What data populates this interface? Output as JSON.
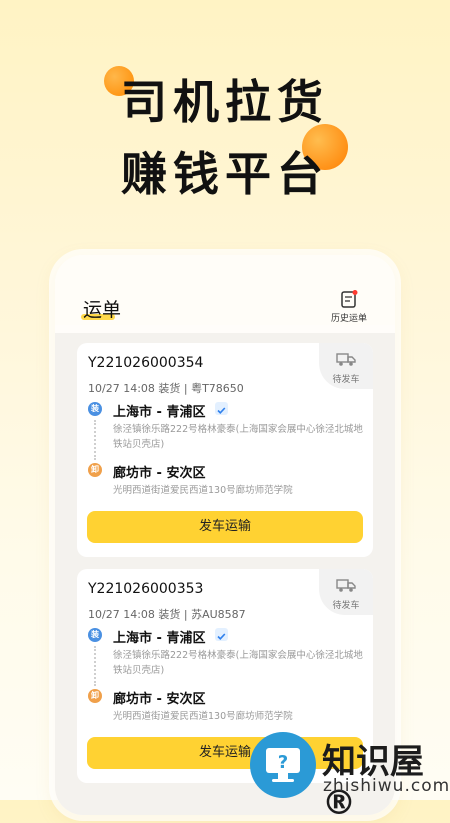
{
  "hero": {
    "line1": "司机拉货",
    "line2": "赚钱平台"
  },
  "header": {
    "title": "运单",
    "history_label": "历史运单"
  },
  "orders": [
    {
      "order_no": "Y221026000354",
      "meta": "10/27 14:08 装货 | 粤T78650",
      "status": "待发车",
      "load_tag": "装",
      "load_city": "上海市 - 青浦区",
      "load_address": "徐泾镇徐乐路222号格林豪泰(上海国家会展中心徐泾北城地铁站贝壳店)",
      "unload_tag": "卸",
      "unload_city": "廊坊市 - 安次区",
      "unload_address": "光明西道街道爱民西道130号廊坊师范学院",
      "button": "发车运输"
    },
    {
      "order_no": "Y221026000353",
      "meta": "10/27 14:08 装货 | 苏AU8587",
      "status": "待发车",
      "load_tag": "装",
      "load_city": "上海市 - 青浦区",
      "load_address": "徐泾镇徐乐路222号格林豪泰(上海国家会展中心徐泾北城地铁站贝壳店)",
      "unload_tag": "卸",
      "unload_city": "廊坊市 - 安次区",
      "unload_address": "光明西道街道爱民西道130号廊坊师范学院",
      "button": "发车运输"
    }
  ],
  "watermark": {
    "name": "知识屋®",
    "domain": "zhishiwu.com"
  },
  "colors": {
    "accent": "#ffd232",
    "load_dot": "#4a90e2",
    "unload_dot": "#f0a04a"
  }
}
